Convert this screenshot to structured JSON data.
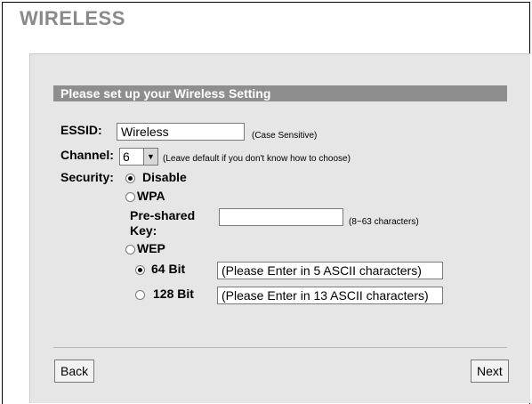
{
  "page": {
    "title": "WIRELESS"
  },
  "section": {
    "header": "Please set up your Wireless Setting"
  },
  "essid": {
    "label": "ESSID:",
    "value": "Wireless",
    "note": "(Case Sensitive)"
  },
  "channel": {
    "label": "Channel:",
    "selected": "6",
    "note": "(Leave default if you don't know how to choose)"
  },
  "security": {
    "label": "Security:",
    "options": {
      "disable": {
        "label": "Disable",
        "checked": true
      },
      "wpa": {
        "label": "WPA",
        "checked": false
      },
      "wep": {
        "label": "WEP",
        "checked": false
      }
    },
    "preshared": {
      "label_line1": "Pre-shared",
      "label_line2": "Key:",
      "value": "",
      "note": "(8~63 characters)"
    },
    "wep_bits": [
      {
        "label": "64 Bit",
        "checked": true,
        "value": "(Please Enter in 5 ASCII characters)"
      },
      {
        "label": "128 Bit",
        "checked": false,
        "value": "(Please Enter in 13 ASCII characters)"
      }
    ]
  },
  "buttons": {
    "back": "Back",
    "next": "Next"
  },
  "icons": {
    "dropdown": "chevron-down-icon"
  },
  "colors": {
    "header_bg": "#8e8e8e",
    "panel_bg": "#e6e6e6",
    "title": "#8a8a8a"
  }
}
